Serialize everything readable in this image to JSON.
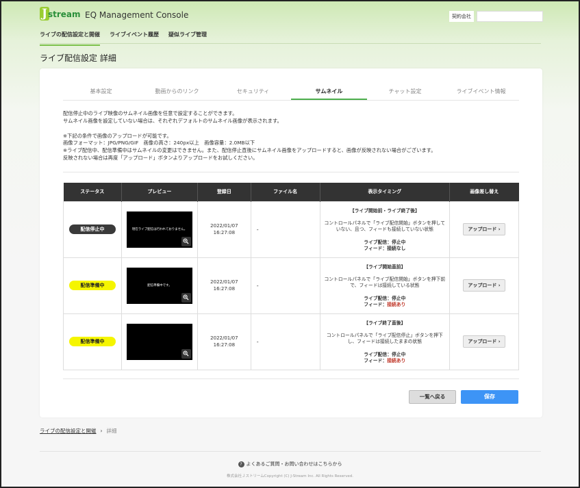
{
  "header": {
    "logo_j": "J",
    "logo_stream": "stream",
    "app_title": "EQ Management Console",
    "contract_label": "契約会社",
    "contract_value": ""
  },
  "topnav": {
    "items": [
      "ライブの配信設定と開催",
      "ライブイベント履歴",
      "疑似ライブ管理"
    ]
  },
  "page_title": "ライブ配信設定 詳細",
  "tabs": [
    "基本設定",
    "動画からのリンク",
    "セキュリティ",
    "サムネイル",
    "チャット設定",
    "ライブイベント情報"
  ],
  "description": {
    "line1": "配信停止中のライブ映像のサムネイル画像を任意で設定することができます。",
    "line2": "サムネイル画像を設定していない場合は、それぞれデフォルトのサムネイル画像が表示されます。",
    "line3": "※下記の条件で画像のアップロードが可能です。",
    "line4": "画像フォーマット：JPG/PNG/GIF　画像の高さ：240px以上　画像容量：2.0MB以下",
    "line5": "※ライブ配信中、配信準備中はサムネイルの変更はできません。また、配信停止直後にサムネイル画像をアップロードすると、画像が反映されない場合がございます。",
    "line6": "反映されない場合は再度「アップロード」ボタンよりアップロードをお試しください。"
  },
  "table": {
    "headers": [
      "ステータス",
      "プレビュー",
      "登録日",
      "ファイル名",
      "表示タイミング",
      "画像差し替え"
    ],
    "rows": [
      {
        "status": "配信停止中",
        "preview_text": "現在ライブ配信は行われておりません。",
        "date": "2022/01/07",
        "time": "16:27:08",
        "file": "-",
        "timing_head": "【ライブ開始前・ライブ終了後】",
        "timing_body": "コントロールパネルで「ライブ配信開始」ボタンを押していない、且つ、フィードも接続していない状態",
        "live_label": "ライブ配信：停止中",
        "feed_label": "フィード：",
        "feed_value": "接続なし",
        "upload": "アップロード ›"
      },
      {
        "status": "配信準備中",
        "preview_text": "配信準備中です。",
        "date": "2022/01/07",
        "time": "16:27:08",
        "file": "-",
        "timing_head": "【ライブ開始直前】",
        "timing_body": "コントロールパネルで「ライブ配信開始」ボタンを押下前で、フィードは接続している状態",
        "live_label": "ライブ配信：停止中",
        "feed_label": "フィード：",
        "feed_value": "接続あり",
        "upload": "アップロード ›"
      },
      {
        "status": "配信準備中",
        "preview_text": "",
        "date": "2022/01/07",
        "time": "16:27:08",
        "file": "-",
        "timing_head": "【ライブ終了直後】",
        "timing_body": "コントロールパネルで「ライブ配信停止」ボタンを押下し、フィードは接続したままの状態",
        "live_label": "ライブ配信：停止中",
        "feed_label": "フィード：",
        "feed_value": "接続あり",
        "upload": "アップロード ›"
      }
    ]
  },
  "buttons": {
    "back": "一覧へ戻る",
    "save": "保存"
  },
  "breadcrumb": {
    "link": "ライブの配信設定と開催",
    "sep": "›",
    "current": "詳細"
  },
  "footer": {
    "faq_icon": "?",
    "faq": "よくあるご質問・お問い合わせはこちらから",
    "copyright": "株式会社ＪストリームCopyright (C) J-Stream Inc. All Rights Reserved."
  },
  "colors": {
    "accent_green": "#7cc04a",
    "tab_active": "#4cae4c",
    "save_blue": "#3d94f6",
    "badge_stop": "#3a3a3a",
    "badge_prep": "#f5f500",
    "feed_red": "#c0392b"
  },
  "icons": [
    "zoom-icon",
    "question-icon",
    "chevron-right-icon"
  ]
}
